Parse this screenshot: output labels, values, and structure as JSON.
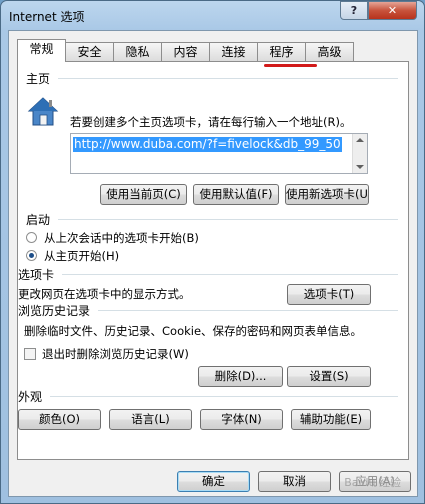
{
  "window": {
    "title": "Internet 选项",
    "help": "?",
    "close": "✕"
  },
  "tabs": [
    "常规",
    "安全",
    "隐私",
    "内容",
    "连接",
    "程序",
    "高级"
  ],
  "homepage": {
    "section": "主页",
    "description": "若要创建多个主页选项卡，请在每行输入一个地址(R)。",
    "url": "http://www.duba.com/?f=fivelock&db_99_50",
    "btn_current": "使用当前页(C)",
    "btn_default": "使用默认值(F)",
    "btn_newtab": "使用新选项卡(U)"
  },
  "startup": {
    "section": "启动",
    "option1": "从上次会话中的选项卡开始(B)",
    "option2": "从主页开始(H)",
    "selected": 2
  },
  "tabsection": {
    "section": "选项卡",
    "description": "更改网页在选项卡中的显示方式。",
    "btn": "选项卡(T)"
  },
  "history": {
    "section": "浏览历史记录",
    "description": "删除临时文件、历史记录、Cookie、保存的密码和网页表单信息。",
    "checkbox": "退出时删除浏览历史记录(W)",
    "checked": false,
    "btn_delete": "删除(D)...",
    "btn_settings": "设置(S)"
  },
  "appearance": {
    "section": "外观",
    "btn_colors": "颜色(O)",
    "btn_languages": "语言(L)",
    "btn_fonts": "字体(N)",
    "btn_accessibility": "辅助功能(E)"
  },
  "footer": {
    "ok": "确定",
    "cancel": "取消",
    "apply": "应用(A)"
  },
  "watermark": "Baidu 经验",
  "colors": {
    "accent_underline": "#d21a1a",
    "selection": "#3399ff"
  }
}
